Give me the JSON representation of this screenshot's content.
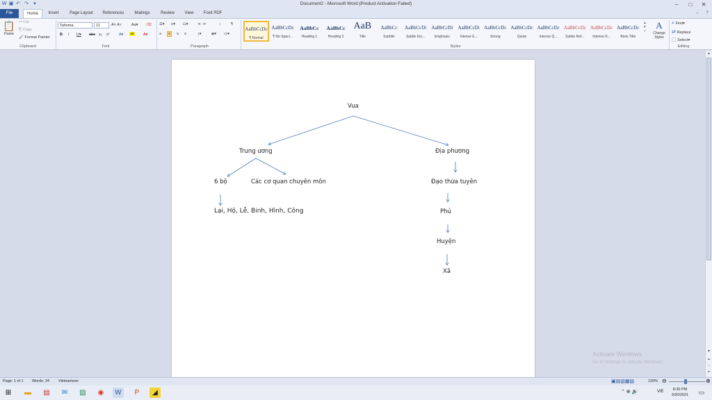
{
  "window": {
    "title": "Document2 - Microsoft Word (Product Activation Failed)",
    "qat_icons": [
      "word-icon",
      "save-icon",
      "undo-icon",
      "redo-icon",
      "customize-icon"
    ],
    "controls": [
      "minimize",
      "maximize",
      "close"
    ]
  },
  "tabs": [
    "File",
    "Home",
    "Insert",
    "Page Layout",
    "References",
    "Mailings",
    "Review",
    "View",
    "Foxit PDF"
  ],
  "active_tab": "Home",
  "ribbon": {
    "clipboard": {
      "paste": "Paste",
      "cut": "Cut",
      "copy": "Copy",
      "format_painter": "Format Painter",
      "label": "Clipboard"
    },
    "font": {
      "family": "Tahoma",
      "size": "11",
      "label": "Font"
    },
    "paragraph": {
      "label": "Paragraph"
    },
    "styles": {
      "label": "Styles",
      "items": [
        {
          "sample": "AaBbCcDc",
          "name": "¶ Normal"
        },
        {
          "sample": "AaBbCcDc",
          "name": "¶ No Spaci..."
        },
        {
          "sample": "AaBbCc",
          "name": "Heading 1"
        },
        {
          "sample": "AaBbCc",
          "name": "Heading 2"
        },
        {
          "sample": "AaB",
          "name": "Title"
        },
        {
          "sample": "AaBbCc",
          "name": "Subtitle"
        },
        {
          "sample": "AaBbCcDi",
          "name": "Subtle Em..."
        },
        {
          "sample": "AaBbCcDi",
          "name": "Emphasis"
        },
        {
          "sample": "AaBbCcDi",
          "name": "Intense E..."
        },
        {
          "sample": "AaBbCcDc",
          "name": "Strong"
        },
        {
          "sample": "AaBbCcDc",
          "name": "Quote"
        },
        {
          "sample": "AaBbCcDc",
          "name": "Intense Q..."
        },
        {
          "sample": "AaBbCcDc",
          "name": "Subtle Ref..."
        },
        {
          "sample": "AaBbCcDc",
          "name": "Intense R..."
        },
        {
          "sample": "AaBbCcDc",
          "name": "Book Title"
        }
      ],
      "change_styles": "Change Styles"
    },
    "editing": {
      "find": "Find",
      "replace": "Replace",
      "select": "Select",
      "label": "Editing"
    }
  },
  "diagram": {
    "root": "Vua",
    "central": "Trung ương",
    "local": "Địa phương",
    "six_ministries": "6 bộ",
    "specialized": "Các cơ quan chuyên môn",
    "ministries_list": "Lại, Hộ, Lễ, Binh, Hình, Công",
    "dao": "Đạo thừa tuyên",
    "phu": "Phủ",
    "huyen": "Huyện",
    "xa": "Xã"
  },
  "status": {
    "page": "Page: 1 of 1",
    "words": "Words: 24",
    "language": "Vietnamese",
    "zoom": "120%"
  },
  "watermark": {
    "line1": "Activate Windows",
    "line2": "Go to Settings to activate Windows."
  },
  "taskbar": {
    "time": "8:30 PM",
    "date": "3/20/2021",
    "lang": "VIE"
  },
  "colors": {
    "file_tab": "#2b579a",
    "arrow": "#4a7ab8",
    "accent": "#2a5699"
  }
}
